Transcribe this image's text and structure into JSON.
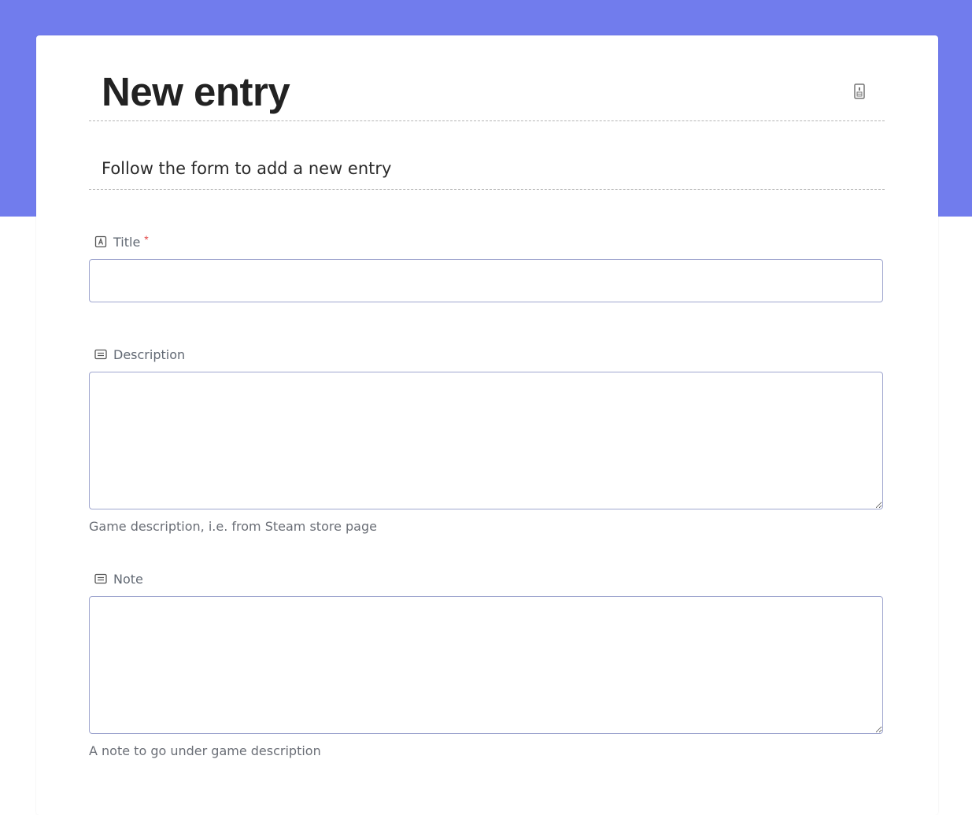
{
  "form": {
    "title": "New entry",
    "subtitle": "Follow the form to add a new entry",
    "header_icon": "form-icon"
  },
  "fields": {
    "title": {
      "label": "Title",
      "required_mark": "*",
      "icon": "text-field-icon",
      "value": "",
      "placeholder": ""
    },
    "description": {
      "label": "Description",
      "icon": "paragraph-field-icon",
      "value": "",
      "placeholder": "",
      "help": "Game description, i.e. from Steam store page"
    },
    "note": {
      "label": "Note",
      "icon": "paragraph-field-icon",
      "value": "",
      "placeholder": "",
      "help": "A note to go under game description"
    }
  },
  "colors": {
    "banner": "#717ced",
    "input_border": "#9fa6cf",
    "required": "#e24545"
  }
}
